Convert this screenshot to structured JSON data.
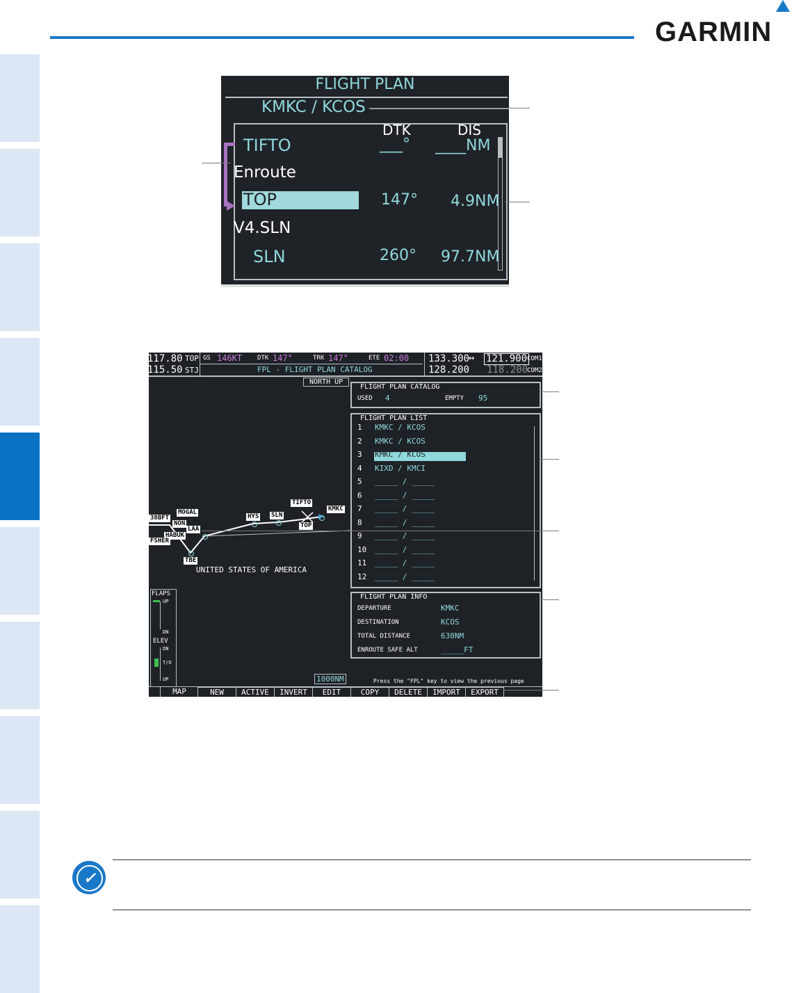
{
  "brand": {
    "logo_text": "GARMIN"
  },
  "top_display": {
    "title": "FLIGHT PLAN",
    "route": "KMKC / KCOS",
    "col_dtk": "DTK",
    "col_dis": "DIS",
    "rows": [
      {
        "name": "TIFTO",
        "dtk": "___°",
        "dis": "____NM"
      },
      {
        "name": "Enroute"
      },
      {
        "name": "TOP",
        "dtk": "147°",
        "dis": "4.9NM"
      },
      {
        "name": "V4.SLN"
      },
      {
        "name": "SLN",
        "dtk": "260°",
        "dis": "97.7NM"
      }
    ]
  },
  "screen": {
    "nav1_freq": "117.80",
    "nav1_id": "TOP",
    "nav2_freq": "115.50",
    "nav2_id": "STJ",
    "gs_label": "GS",
    "gs_value": "146KT",
    "dtk_label": "DTK",
    "dtk_value": "147°",
    "trk_label": "TRK",
    "trk_value": "147°",
    "ete_label": "ETE",
    "ete_value": "02:00",
    "page_title": "FPL - FLIGHT PLAN CATALOG",
    "com1_active": "133.300",
    "com1_standby": "121.900",
    "com1_label": "COM1",
    "com2_active": "128.200",
    "com2_standby": "118.200",
    "com2_label": "COM2",
    "swap": "↔",
    "north_up": "NORTH UP",
    "map_labels": [
      "MOGAL",
      "TIFTO",
      "KMKC",
      "HYS",
      "SLN",
      "TOP",
      "LAA",
      "HABUK",
      "TBE",
      "FSHER",
      "38BFT",
      "NON"
    ],
    "country": "UNITED STATES OF AMERICA",
    "range": "1000NM",
    "flaps_label": "FLAPS",
    "flaps_up": "UP",
    "flaps_dn": "DN",
    "elev_label": "ELEV",
    "elev_dn": "DN",
    "elev_to": "T/O",
    "elev_up": "UP",
    "catalog": {
      "title": "FLIGHT PLAN CATALOG",
      "used_label": "USED",
      "used": "4",
      "empty_label": "EMPTY",
      "empty": "95"
    },
    "list": {
      "title": "FLIGHT PLAN LIST",
      "items": [
        {
          "n": "1",
          "route": "KMKC / KCOS"
        },
        {
          "n": "2",
          "route": "KMKC / KCOS"
        },
        {
          "n": "3",
          "route": "KMKC / KCOS"
        },
        {
          "n": "4",
          "route": "KIXD / KMCI"
        },
        {
          "n": "5",
          "route": "_____ / _____"
        },
        {
          "n": "6",
          "route": "_____ / _____"
        },
        {
          "n": "7",
          "route": "_____ / _____"
        },
        {
          "n": "8",
          "route": "_____ / _____"
        },
        {
          "n": "9",
          "route": "_____ / _____"
        },
        {
          "n": "10",
          "route": "_____ / _____"
        },
        {
          "n": "11",
          "route": "_____ / _____"
        },
        {
          "n": "12",
          "route": "_____ / _____"
        }
      ]
    },
    "info": {
      "title": "FLIGHT PLAN INFO",
      "departure_label": "DEPARTURE",
      "departure": "KMKC",
      "destination_label": "DESTINATION",
      "destination": "KCOS",
      "distance_label": "TOTAL DISTANCE",
      "distance": "630NM",
      "safe_alt_label": "ENROUTE SAFE ALT",
      "safe_alt": "_____FT"
    },
    "hint": "Press the \"FPL\" key to view the previous page",
    "softkeys": [
      "MAP",
      "NEW",
      "ACTIVE",
      "INVERT",
      "EDIT",
      "COPY",
      "DELETE",
      "IMPORT",
      "EXPORT"
    ]
  },
  "note_icon": "✓"
}
